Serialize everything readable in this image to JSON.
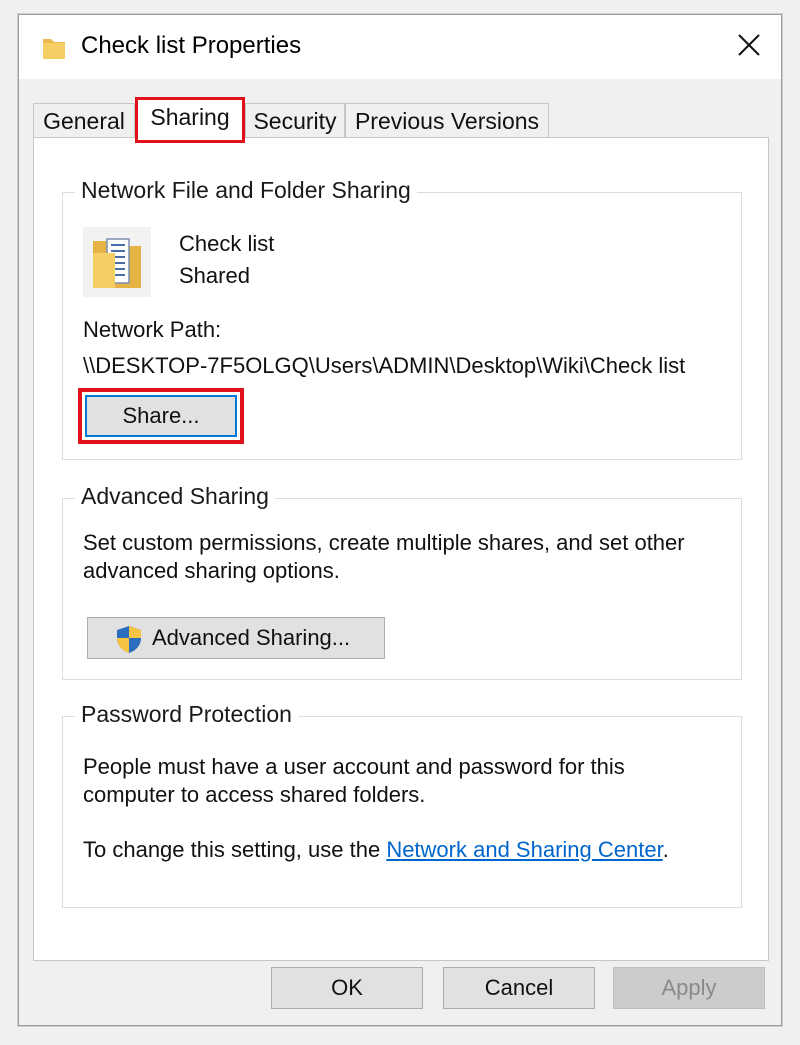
{
  "window": {
    "title": "Check list Properties",
    "close_symbol": "✕"
  },
  "tabs": [
    {
      "label": "General",
      "active": false
    },
    {
      "label": "Sharing",
      "active": true
    },
    {
      "label": "Security",
      "active": false
    },
    {
      "label": "Previous Versions",
      "active": false
    }
  ],
  "network_sharing": {
    "group_title": "Network File and Folder Sharing",
    "folder_name": "Check list",
    "folder_status": "Shared",
    "path_label": "Network Path:",
    "path_value": "\\\\DESKTOP-7F5OLGQ\\Users\\ADMIN\\Desktop\\Wiki\\Check list",
    "share_button": "Share..."
  },
  "advanced_sharing": {
    "group_title": "Advanced Sharing",
    "description": "Set custom permissions, create multiple shares, and set other advanced sharing options.",
    "button": "Advanced Sharing..."
  },
  "password_protection": {
    "group_title": "Password Protection",
    "description": "People must have a user account and password for this computer to access shared folders.",
    "change_prefix": "To change this setting, use the ",
    "link_text": "Network and Sharing Center",
    "change_suffix": "."
  },
  "footer": {
    "ok": "OK",
    "cancel": "Cancel",
    "apply": "Apply"
  },
  "colors": {
    "highlight": "#e2101b",
    "focus": "#0078d7",
    "link": "#0066cc"
  },
  "icons": {
    "title": "folder-icon",
    "folder": "shared-folder-icon",
    "shield": "uac-shield-icon",
    "close": "close-icon"
  }
}
